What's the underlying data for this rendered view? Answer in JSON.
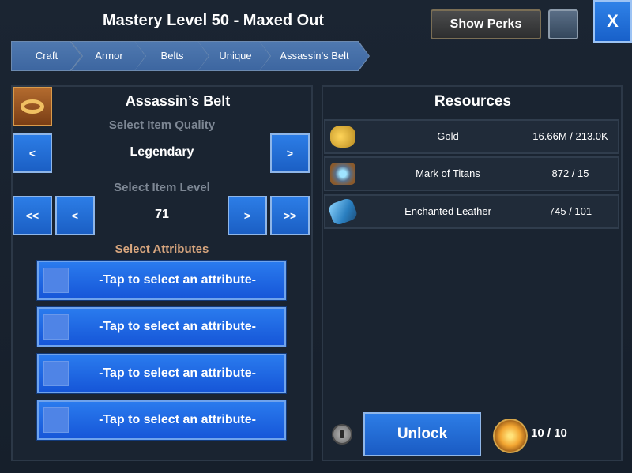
{
  "header": {
    "title": "Mastery Level 50 - Maxed Out",
    "show_perks_label": "Show Perks",
    "close_label": "X"
  },
  "breadcrumb": [
    "Craft",
    "Armor",
    "Belts",
    "Unique",
    "Assassin’s Belt"
  ],
  "item": {
    "name": "Assassin’s Belt",
    "quality_label": "Select Item Quality",
    "quality_value": "Legendary",
    "level_label": "Select Item Level",
    "level_value": "71",
    "attributes_label": "Select Attributes"
  },
  "buttons": {
    "prev": "<",
    "next": ">",
    "first": "<<",
    "last": ">>"
  },
  "attributes": [
    "-Tap to select an attribute-",
    "-Tap to select an attribute-",
    "-Tap to select an attribute-",
    "-Tap to select an attribute-"
  ],
  "resources": {
    "title": "Resources",
    "items": [
      {
        "name": "Gold",
        "amount": "16.66M / 213.0K",
        "icon": "gold-coins-icon"
      },
      {
        "name": "Mark of Titans",
        "amount": "872 / 15",
        "icon": "mark-of-titans-icon"
      },
      {
        "name": "Enchanted Leather",
        "amount": "745 / 101",
        "icon": "enchanted-leather-icon"
      }
    ]
  },
  "footer": {
    "unlock_label": "Unlock",
    "orb_count": "10 / 10"
  }
}
